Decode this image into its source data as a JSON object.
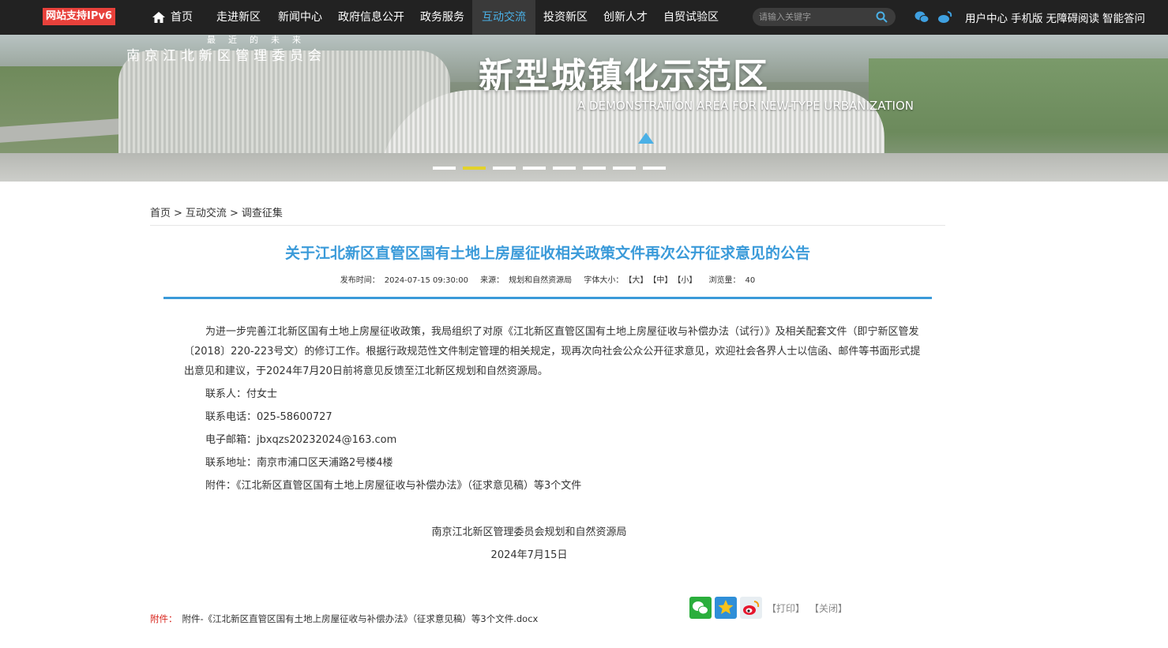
{
  "topbar": {
    "ipv6_badge": "网站支持IPv6",
    "nav": [
      "首页",
      "走进新区",
      "新闻中心",
      "政府信息公开",
      "政务服务",
      "互动交流",
      "投资新区",
      "创新人才",
      "自贸试验区"
    ],
    "active_nav": "互动交流",
    "search_placeholder": "请输入关键字",
    "links": [
      "用户中心",
      "手机版",
      "无障碍阅读",
      "智能答问"
    ]
  },
  "banner": {
    "logo_sub": "最近的未来",
    "logo_name": "南京江北新区管理委员会",
    "title_cn": "新型城镇化示范区",
    "title_en": "A DEMONSTRATION AREA FOR NEW-TYPE URBANIZATION",
    "slide_count": 8,
    "active_slide": 2
  },
  "breadcrumb": [
    "首页",
    "互动交流",
    "调查征集"
  ],
  "article": {
    "title": "关于江北新区直管区国有土地上房屋征收相关政策文件再次公开征求意见的公告",
    "meta": {
      "publish_label": "发布时间：",
      "publish_time": "2024-07-15 09:30:00",
      "source_label": "来源：",
      "source": "规划和自然资源局",
      "fontsize_label": "字体大小：",
      "fontsize_options": [
        "【大】",
        "【中】",
        "【小】"
      ],
      "views_label": "浏览量：",
      "views": "40"
    },
    "paragraph": "为进一步完善江北新区国有土地上房屋征收政策，我局组织了对原《江北新区直管区国有土地上房屋征收与补偿办法（试行）》及相关配套文件（即宁新区管发〔2018〕220-223号文）的修订工作。根据行政规范性文件制定管理的相关规定，现再次向社会公众公开征求意见，欢迎社会各界人士以信函、邮件等书面形式提出意见和建议，于2024年7月20日前将意见反馈至江北新区规划和自然资源局。",
    "items": [
      "联系人：付女士",
      "联系电话：025-58600727",
      "电子邮箱：jbxqzs20232024@163.com",
      "联系地址：南京市浦口区天浦路2号楼4楼",
      "附件：《江北新区直管区国有土地上房屋征收与补偿办法》（征求意见稿）等3个文件"
    ],
    "signature_org": "南京江北新区管理委员会规划和自然资源局",
    "signature_date": "2024年7月15日"
  },
  "attachment": {
    "label": "附件：",
    "file": "附件-《江北新区直管区国有土地上房屋征收与补偿办法》（征求意见稿）等3个文件.docx"
  },
  "actions": {
    "print": "【打印】",
    "close": "【关闭】",
    "share_icons": [
      "wechat-icon",
      "qzone-icon",
      "weibo-icon"
    ]
  },
  "colors": {
    "topbar_bg": "#222222",
    "accent_blue": "#3a9ad9",
    "ipv6_red": "#e8413b",
    "attach_red": "#d8261e",
    "active_dot": "#e3d22a"
  }
}
